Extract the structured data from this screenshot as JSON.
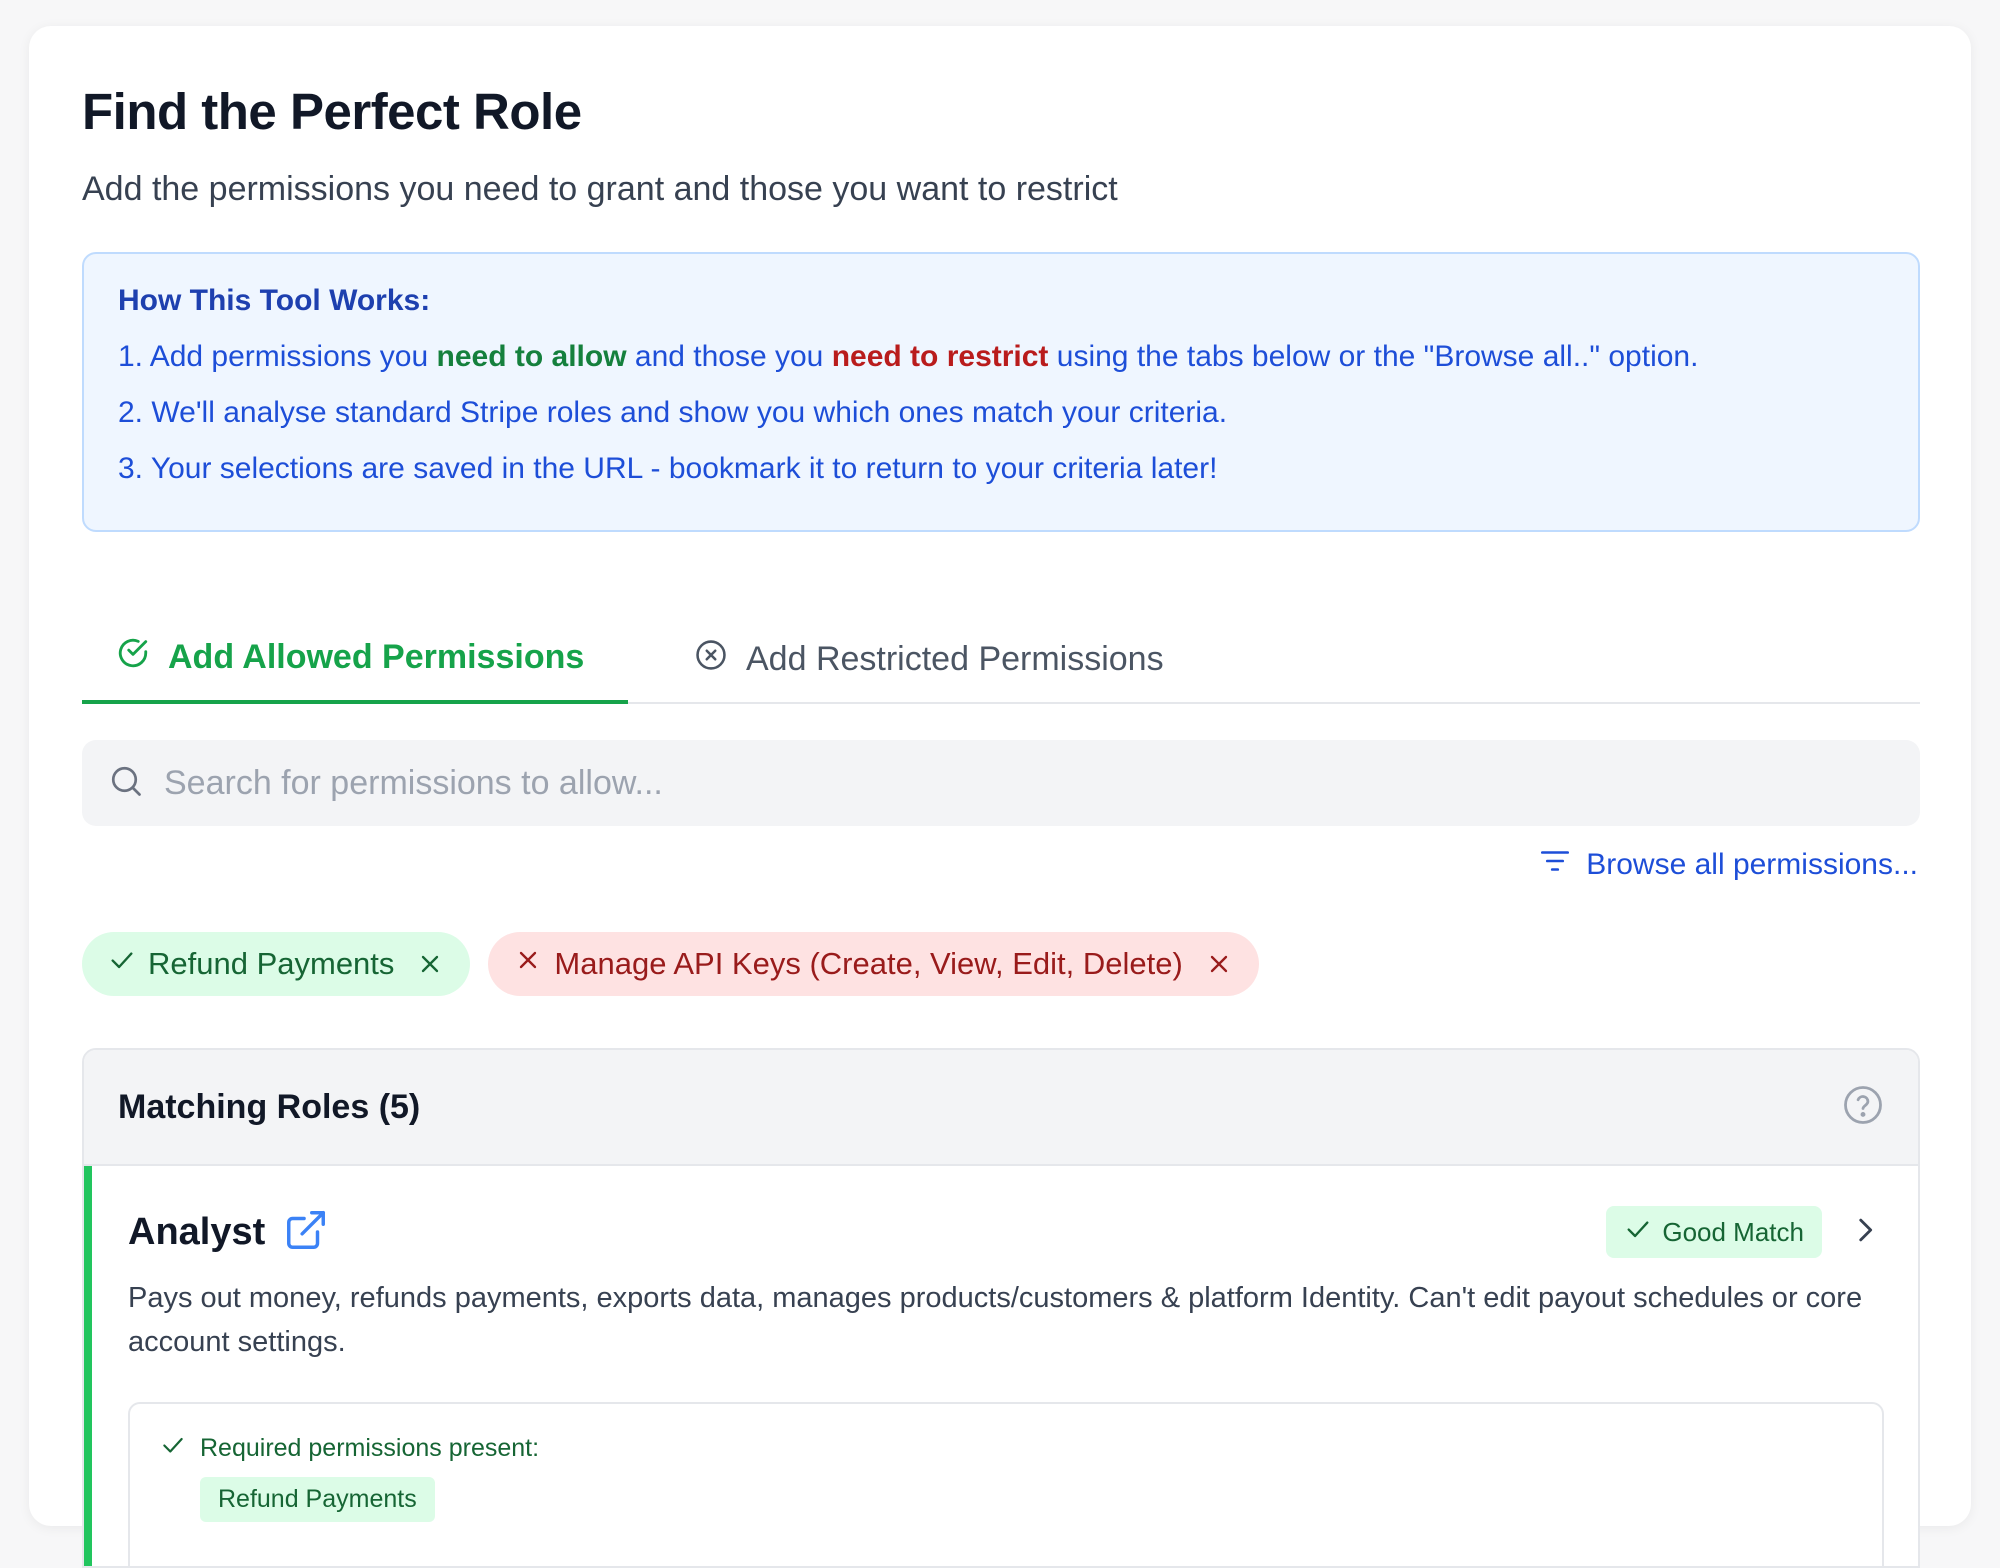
{
  "header": {
    "title": "Find the Perfect Role",
    "subtitle": "Add the permissions you need to grant and those you want to restrict"
  },
  "info": {
    "title": "How This Tool Works:",
    "line1_prefix": "1. Add permissions you ",
    "line1_allow": "need to allow",
    "line1_middle": " and those you ",
    "line1_restrict": "need to restrict",
    "line1_suffix": " using the tabs below or the \"Browse all..\" option.",
    "line2": "2. We'll analyse standard Stripe roles and show you which ones match your criteria.",
    "line3": "3. Your selections are saved in the URL - bookmark it to return to your criteria later!"
  },
  "tabs": [
    {
      "label": "Add Allowed Permissions",
      "active": true,
      "icon": "check-circle-icon"
    },
    {
      "label": "Add Restricted Permissions",
      "active": false,
      "icon": "x-circle-icon"
    }
  ],
  "search": {
    "placeholder": "Search for permissions to allow...",
    "value": ""
  },
  "browse": {
    "label": "Browse all permissions..."
  },
  "chips": {
    "allowed": [
      {
        "label": "Refund Payments"
      }
    ],
    "restricted": [
      {
        "label": "Manage API Keys (Create, View, Edit, Delete)"
      }
    ]
  },
  "roles": {
    "title": "Matching Roles (5)",
    "items": [
      {
        "name": "Analyst",
        "match": "Good Match",
        "description": "Pays out money, refunds payments, exports data, manages products/customers & platform Identity. Can't edit payout schedules or core account settings.",
        "required_label": "Required permissions present:",
        "required": [
          "Refund Payments"
        ]
      }
    ]
  },
  "colors": {
    "accent_green": "#16a34a",
    "accent_blue": "#1d4ed8",
    "danger_red": "#b91c1c"
  }
}
